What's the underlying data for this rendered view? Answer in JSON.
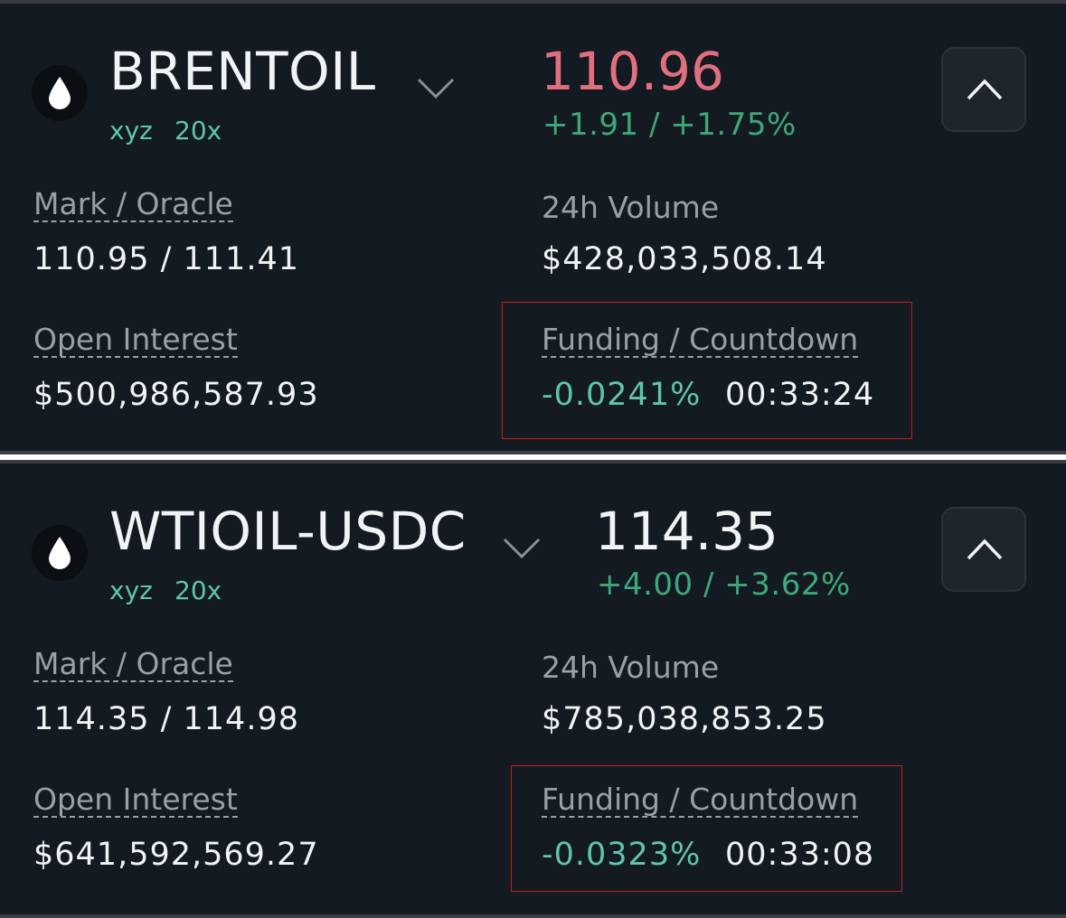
{
  "markets": [
    {
      "symbol": "BRENTOIL",
      "dex": "xyz",
      "leverage": "20x",
      "price": "110.96",
      "price_color": "#e0707e",
      "change": "+1.91 / +1.75%",
      "mark_oracle_label": "Mark / Oracle",
      "mark_oracle": "110.95 / 111.41",
      "volume_label": "24h Volume",
      "volume": "$428,033,508.14",
      "open_interest_label": "Open Interest",
      "open_interest": "$500,986,587.93",
      "funding_label": "Funding / Countdown",
      "funding_rate": "-0.0241%",
      "countdown": "00:33:24"
    },
    {
      "symbol": "WTIOIL-USDC",
      "dex": "xyz",
      "leverage": "20x",
      "price": "114.35",
      "price_color": "#f2f3f5",
      "change": "+4.00 / +3.62%",
      "mark_oracle_label": "Mark / Oracle",
      "mark_oracle": "114.35 / 114.98",
      "volume_label": "24h Volume",
      "volume": "$785,038,853.25",
      "open_interest_label": "Open Interest",
      "open_interest": "$641,592,569.27",
      "funding_label": "Funding / Countdown",
      "funding_rate": "-0.0323%",
      "countdown": "00:33:08"
    }
  ],
  "icons": {
    "coin": "oil-drop-icon",
    "selector": "chevron-down-icon",
    "collapse": "chevron-up-icon"
  },
  "colors": {
    "background": "#131a21",
    "positive": "#3fa77a",
    "accent": "#5fc4b0",
    "highlight": "#c0201a"
  }
}
